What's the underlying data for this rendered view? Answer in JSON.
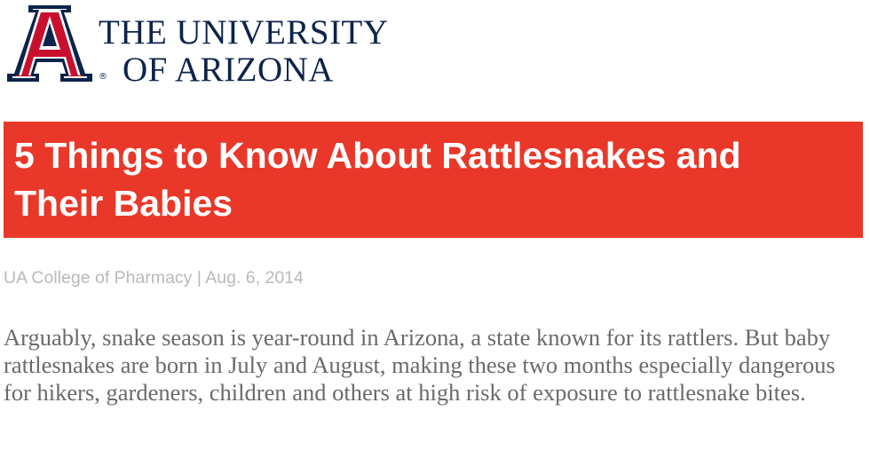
{
  "header": {
    "logo_line1": "THE UNIVERSITY",
    "logo_line2": "OF ARIZONA",
    "registered_mark": "®"
  },
  "colors": {
    "navy": "#0c234b",
    "red": "#e93829",
    "byline_gray": "#b9b9b9",
    "body_gray": "#6a6a6a"
  },
  "article": {
    "title": "5 Things to Know About Rattlesnakes and Their Babies",
    "byline": "UA College of Pharmacy | Aug. 6, 2014",
    "lead": "Arguably, snake season is year-round in Arizona, a state known for its rattlers. But baby rattlesnakes are born in July and August, making these two months especially dangerous for hikers, gardeners, children and others at high risk of exposure to rattlesnake bites."
  }
}
